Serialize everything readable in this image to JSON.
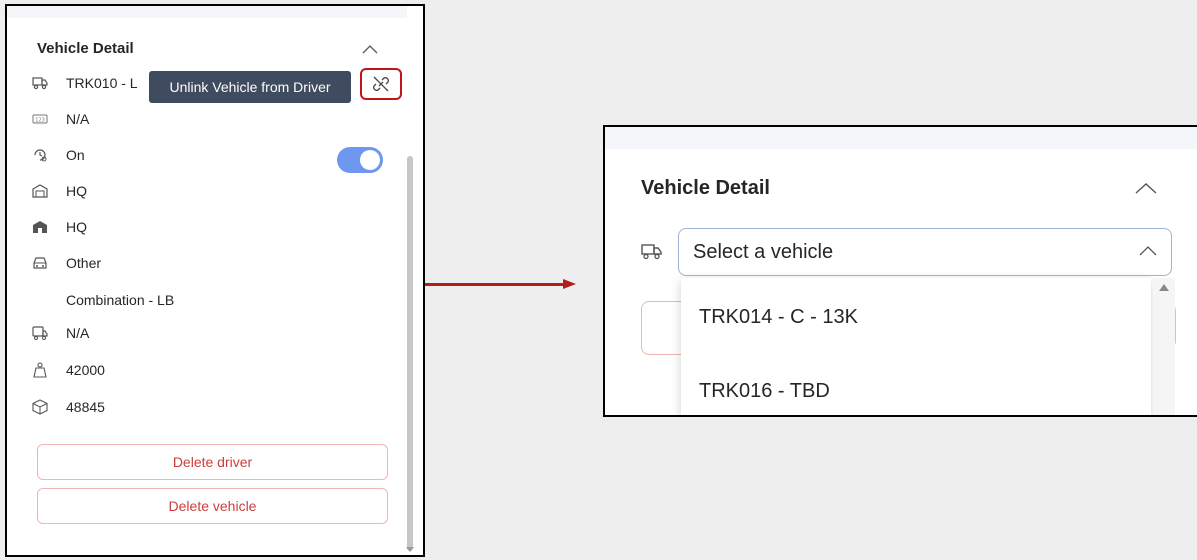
{
  "left_panel": {
    "title": "Vehicle Detail",
    "rows": [
      {
        "icon": "truck-icon",
        "text": "TRK010 - L"
      },
      {
        "icon": "number-plate-icon",
        "text": "N/A"
      },
      {
        "icon": "history-settings-icon",
        "text": "On"
      },
      {
        "icon": "garage-icon",
        "text": "HQ"
      },
      {
        "icon": "home-base-icon",
        "text": "HQ"
      },
      {
        "icon": "car-icon",
        "text": "Other"
      },
      {
        "icon": "",
        "text": "Combination - LB"
      },
      {
        "icon": "trailer-truck-icon",
        "text": "N/A"
      },
      {
        "icon": "weight-icon",
        "text": "42000"
      },
      {
        "icon": "package-icon",
        "text": "48845"
      }
    ],
    "tooltip": "Unlink Vehicle from Driver",
    "toggle_state": "on",
    "delete_driver": "Delete driver",
    "delete_vehicle": "Delete vehicle"
  },
  "right_panel": {
    "title": "Vehicle Detail",
    "select_placeholder": "Select a vehicle",
    "options": [
      "TRK014 - C - 13K",
      "TRK016 - TBD"
    ]
  },
  "colors": {
    "accent_blue": "#6e97f0",
    "danger_red": "#cc3d3d",
    "highlight_red": "#c0151b",
    "tooltip_bg": "#3f4b5e"
  }
}
